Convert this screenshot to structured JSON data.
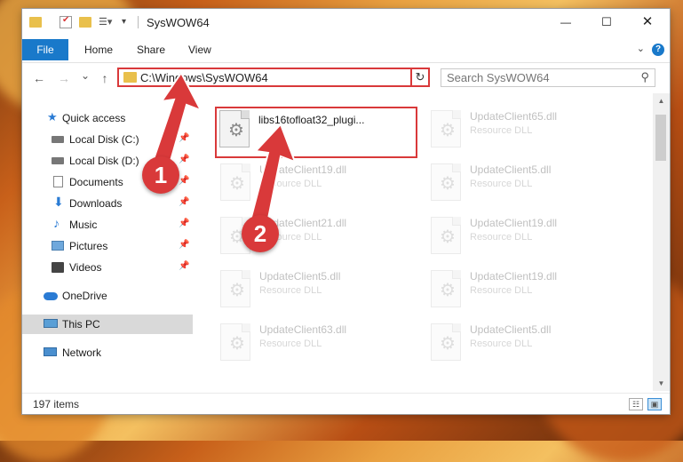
{
  "window": {
    "title": "SysWOW64"
  },
  "ribbon": {
    "tabs": [
      "File",
      "Home",
      "Share",
      "View"
    ],
    "help": "?"
  },
  "controls": {
    "minimize": "—",
    "maximize": "☐",
    "close": "✕"
  },
  "navbar": {
    "back": "←",
    "forward": "→",
    "recent": "⌄",
    "up": "↑",
    "address_path": "C:\\Windows\\SysWOW64",
    "refresh": "↻",
    "search_placeholder": "Search SysWOW64"
  },
  "sidebar": {
    "items": [
      {
        "label": "Quick access"
      },
      {
        "label": "Local Disk (C:)"
      },
      {
        "label": "Local Disk (D:)"
      },
      {
        "label": "Documents"
      },
      {
        "label": "Downloads"
      },
      {
        "label": "Music"
      },
      {
        "label": "Pictures"
      },
      {
        "label": "Videos"
      },
      {
        "label": "OneDrive"
      },
      {
        "label": "This PC"
      },
      {
        "label": "Network"
      }
    ]
  },
  "files": [
    {
      "name": "libs16tofloat32_plugi...",
      "type": ""
    },
    {
      "name": "UpdateClient65.dll",
      "type": "Resource DLL"
    },
    {
      "name": "UpdateClient19.dll",
      "type": "Resource DLL"
    },
    {
      "name": "UpdateClient5.dll",
      "type": "Resource DLL"
    },
    {
      "name": "UpdateClient21.dll",
      "type": "Resource DLL"
    },
    {
      "name": "UpdateClient19.dll",
      "type": "Resource DLL"
    },
    {
      "name": "UpdateClient5.dll",
      "type": "Resource DLL"
    },
    {
      "name": "UpdateClient19.dll",
      "type": "Resource DLL"
    },
    {
      "name": "UpdateClient63.dll",
      "type": "Resource DLL"
    },
    {
      "name": "UpdateClient5.dll",
      "type": "Resource DLL"
    }
  ],
  "status": {
    "count": "197 items"
  },
  "annotations": {
    "step1": "1",
    "step2": "2"
  },
  "colors": {
    "accent": "#1979ca",
    "highlight": "#d9393a"
  }
}
